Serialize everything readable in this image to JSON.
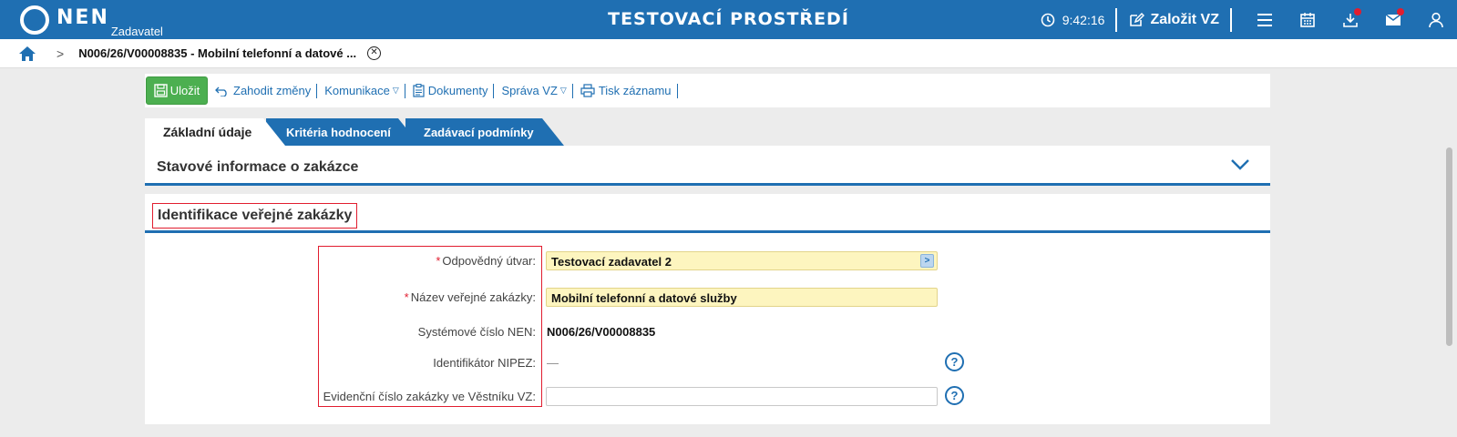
{
  "header": {
    "logo_text": "NEN",
    "logo_sub": "Zadavatel",
    "env_title": "TESTOVACÍ PROSTŘEDÍ",
    "clock": "9:42:16",
    "create_label": "Založit VZ",
    "icons": [
      "menu-icon",
      "calendar-icon",
      "download-icon",
      "mail-icon",
      "user-icon"
    ],
    "accent": "#1f6fb2",
    "notification_color": "#e11d2f"
  },
  "breadcrumb": {
    "current": "N006/26/V00008835 - Mobilní telefonní a datové ...",
    "separator": ">"
  },
  "toolbar": {
    "save_label": "Uložit",
    "discard_label": "Zahodit změny",
    "communication_label": "Komunikace",
    "documents_label": "Dokumenty",
    "manage_label": "Správa VZ",
    "print_label": "Tisk záznamu"
  },
  "tabs": [
    {
      "label": "Základní údaje",
      "active": true
    },
    {
      "label": "Kritéria hodnocení",
      "active": false
    },
    {
      "label": "Zadávací podmínky",
      "active": false
    }
  ],
  "panels": {
    "status_title": "Stavové informace o zakázce",
    "identification_title": "Identifikace veřejné zakázky"
  },
  "form": {
    "required_mark": "*",
    "unit_label": "Odpovědný útvar:",
    "unit_value": "Testovací zadavatel 2",
    "name_label": "Název veřejné zakázky:",
    "name_value": "Mobilní telefonní a datové služby",
    "system_number_label": "Systémové číslo NEN:",
    "system_number_value": "N006/26/V00008835",
    "nipez_label": "Identifikátor NIPEZ:",
    "nipez_value": "—",
    "journal_label": "Evidenční číslo zakázky ve Věstníku VZ:",
    "journal_value": "",
    "help_glyph": "?"
  }
}
